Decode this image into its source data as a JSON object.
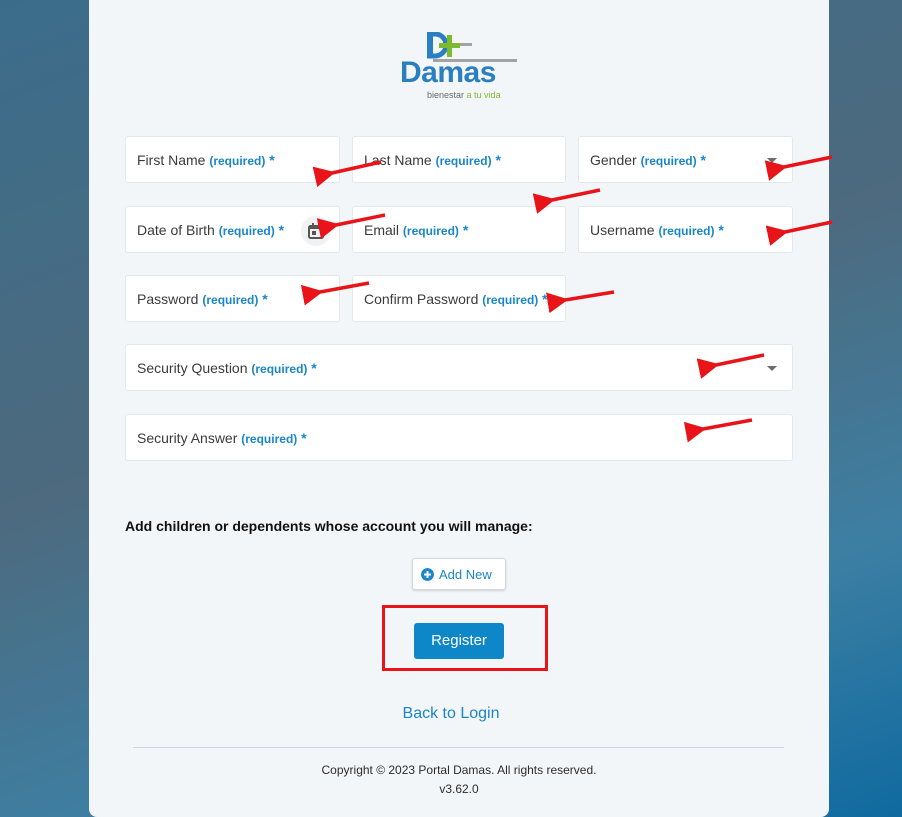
{
  "logo": {
    "name": "Damas",
    "tagline_prefix": "bienestar",
    "tagline_highlight": "a tu vida"
  },
  "fields": {
    "first_name": {
      "label": "First Name",
      "req": "(required)",
      "star": "*"
    },
    "last_name": {
      "label": "Last Name",
      "req": "(required)",
      "star": "*"
    },
    "gender": {
      "label": "Gender",
      "req": "(required)",
      "star": "*"
    },
    "dob": {
      "label": "Date of Birth",
      "req": "(required)",
      "star": "*"
    },
    "email": {
      "label": "Email",
      "req": "(required)",
      "star": "*"
    },
    "username": {
      "label": "Username",
      "req": "(required)",
      "star": "*"
    },
    "password": {
      "label": "Password",
      "req": "(required)",
      "star": "*"
    },
    "confirm_password": {
      "label": "Confirm Password",
      "req": "(required)",
      "star": "*"
    },
    "security_question": {
      "label": "Security Question",
      "req": "(required)",
      "star": "*"
    },
    "security_answer": {
      "label": "Security Answer",
      "req": "(required)",
      "star": "*"
    }
  },
  "dependents": {
    "heading": "Add children or dependents whose account you will manage:",
    "add_label": "Add New"
  },
  "register_label": "Register",
  "back_label": "Back to Login",
  "footer": {
    "copyright": "Copyright © 2023 Portal Damas. All rights reserved.",
    "version": "v3.62.0"
  },
  "colors": {
    "accent": "#1a86c7",
    "button": "#0e87c9",
    "annotation": "#e8141a",
    "logo_green": "#7dbb2e"
  },
  "icons": [
    "calendar-icon",
    "chevron-down-icon",
    "plus-circle-icon",
    "arrow-annotation"
  ]
}
